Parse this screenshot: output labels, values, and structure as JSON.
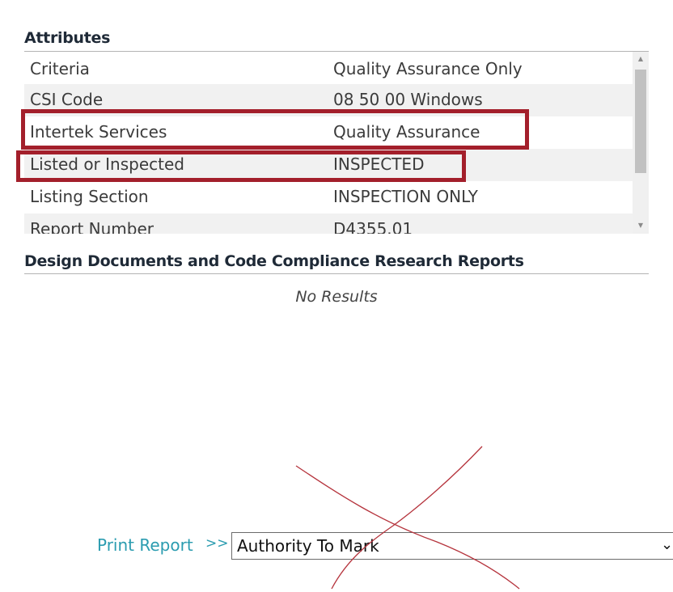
{
  "attributes": {
    "heading": "Attributes",
    "rows": [
      {
        "key": "Criteria",
        "value": "Quality Assurance Only"
      },
      {
        "key": "CSI Code",
        "value": "08 50 00 Windows"
      },
      {
        "key": "Intertek Services",
        "value": "Quality Assurance"
      },
      {
        "key": "Listed or Inspected",
        "value": "INSPECTED"
      },
      {
        "key": "Listing Section",
        "value": "INSPECTION ONLY"
      },
      {
        "key": "Report Number",
        "value": "D4355.01"
      }
    ]
  },
  "design_documents": {
    "heading": "Design Documents and Code Compliance Research Reports",
    "empty_text": "No Results"
  },
  "print": {
    "link_label": "Print Report",
    "arrows": ">>",
    "selected_option": "Authority To Mark"
  },
  "annotations": {
    "highlight_color": "#a31f2b",
    "scribble_color": "#b5333c"
  },
  "icons": {
    "scroll_up": "scroll-up-arrow-icon",
    "scroll_down": "scroll-down-arrow-icon",
    "dropdown": "chevron-down-icon"
  }
}
